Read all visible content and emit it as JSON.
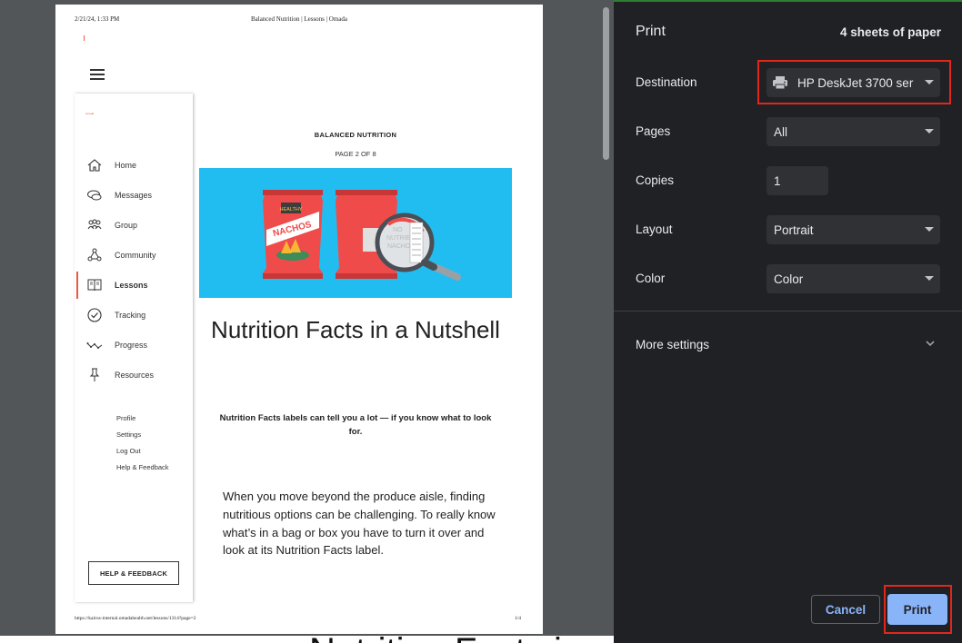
{
  "preview": {
    "header_date": "2/21/24, 1:33 PM",
    "header_title": "Balanced Nutrition | Lessons | Omada",
    "footer_url": "https://kairos-internal.omadahealth.net/lessons/1314?page=2",
    "footer_page": "1/4",
    "side_logo": "omada",
    "nav_items": [
      {
        "label": "Home",
        "icon": "home-icon"
      },
      {
        "label": "Messages",
        "icon": "messages-icon"
      },
      {
        "label": "Group",
        "icon": "group-icon"
      },
      {
        "label": "Community",
        "icon": "community-icon"
      },
      {
        "label": "Lessons",
        "icon": "lessons-icon",
        "active": true
      },
      {
        "label": "Tracking",
        "icon": "tracking-icon"
      },
      {
        "label": "Progress",
        "icon": "progress-icon"
      },
      {
        "label": "Resources",
        "icon": "resources-icon"
      }
    ],
    "sub_links": [
      "Profile",
      "Settings",
      "Log Out",
      "Help & Feedback"
    ],
    "help_button": "HELP & FEEDBACK",
    "lesson": {
      "kicker": "BALANCED NUTRITION",
      "page": "PAGE 2 OF 8",
      "title": "Nutrition Facts in a Nutshell",
      "subtitle": "Nutrition Facts labels can tell you a lot — if you know what to look for.",
      "body": "When you move beyond the produce aisle, finding nutritious options can be challenging. To really know what’s in a bag or box you have to turn it over and look at its Nutrition Facts label."
    },
    "hero": {
      "bag1_badge": "HEALTHY",
      "bag1_text": "NACHOS",
      "bag2_text": [
        "NO",
        "NUTRIENT",
        "NACHOS"
      ]
    },
    "bottom_strip_text": "Nutrition Facts in a Nutshell"
  },
  "settings": {
    "title": "Print",
    "sheets": "4 sheets of paper",
    "destination_label": "Destination",
    "destination_value": "HP DeskJet 3700 ser",
    "pages_label": "Pages",
    "pages_value": "All",
    "copies_label": "Copies",
    "copies_value": "1",
    "layout_label": "Layout",
    "layout_value": "Portrait",
    "color_label": "Color",
    "color_value": "Color",
    "more_settings": "More settings",
    "cancel": "Cancel",
    "print": "Print"
  },
  "colors": {
    "panel_bg": "#202124",
    "control_bg": "#303134",
    "accent_blue": "#8ab4f8",
    "highlight_red": "#e3261c",
    "omada_orange": "#e8583d",
    "hero_blue": "#22bdf0"
  }
}
